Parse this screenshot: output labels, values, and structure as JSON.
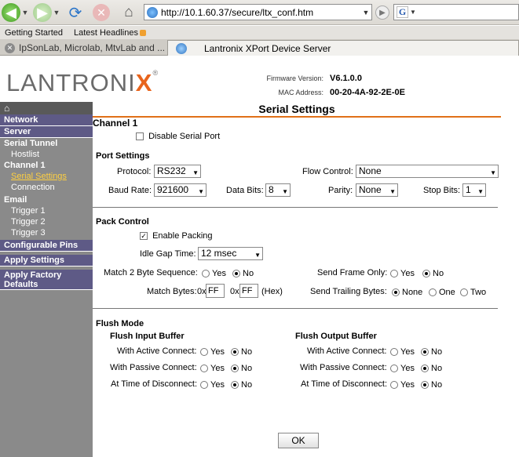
{
  "browser": {
    "url": "http://10.1.60.37/secure/ltx_conf.htm",
    "bookmarks": [
      "Getting Started",
      "Latest Headlines"
    ],
    "tabs": [
      "IpSonLab, Microlab, MtvLab and ...",
      "Lantronix XPort Device Server"
    ],
    "icons": [
      "back-icon",
      "forward-icon",
      "reload-icon",
      "stop-icon",
      "home-icon",
      "go-icon",
      "google-search-icon"
    ]
  },
  "header": {
    "logo_main": "LANTRONI",
    "logo_x": "X",
    "logo_reg": "®",
    "firmware_label": "Firmware Version:",
    "firmware_value": "V6.1.0.0",
    "mac_label": "MAC Address:",
    "mac_value": "00-20-4A-92-2E-0E",
    "brand_color": "#e8641c"
  },
  "sidebar": {
    "home_icon": "⌂",
    "items": [
      {
        "label": "Network"
      },
      {
        "label": "Server"
      },
      {
        "label": "Serial Tunnel"
      },
      {
        "label": "Hostlist"
      },
      {
        "label": "Channel 1"
      },
      {
        "label": "Serial Settings"
      },
      {
        "label": "Connection"
      },
      {
        "label": "Email"
      },
      {
        "label": "Trigger 1"
      },
      {
        "label": "Trigger 2"
      },
      {
        "label": "Trigger 3"
      },
      {
        "label": "Configurable Pins"
      },
      {
        "label": "Apply Settings"
      },
      {
        "label": "Apply Factory Defaults"
      }
    ]
  },
  "main": {
    "title": "Serial Settings",
    "channel": "Channel 1",
    "disable_serial_port": {
      "label": "Disable Serial Port",
      "checked": false
    },
    "port_settings": {
      "heading": "Port Settings",
      "protocol_label": "Protocol:",
      "protocol_value": "RS232",
      "flow_label": "Flow Control:",
      "flow_value": "None",
      "baud_label": "Baud Rate:",
      "baud_value": "921600",
      "databits_label": "Data Bits:",
      "databits_value": "8",
      "parity_label": "Parity:",
      "parity_value": "None",
      "stopbits_label": "Stop Bits:",
      "stopbits_value": "1"
    },
    "pack_control": {
      "heading": "Pack Control",
      "enable_packing": {
        "label": "Enable Packing",
        "checked": true,
        "mark": "✓"
      },
      "idle_gap_label": "Idle Gap Time:",
      "idle_gap_value": "12 msec",
      "match2_label": "Match 2 Byte Sequence:",
      "yes": "Yes",
      "no": "No",
      "send_frame_label": "Send Frame Only:",
      "match_bytes_label": "Match Bytes:",
      "hex_prefix": "0x",
      "byte1": "FF",
      "byte2": "FF",
      "hex_suffix": "(Hex)",
      "send_trailing_label": "Send Trailing Bytes:",
      "trail_none": "None",
      "trail_one": "One",
      "trail_two": "Two"
    },
    "flush_mode": {
      "heading": "Flush Mode",
      "input_heading": "Flush Input Buffer",
      "output_heading": "Flush Output Buffer",
      "active_label": "With Active Connect:",
      "passive_label": "With Passive Connect:",
      "disconnect_label": "At Time of Disconnect:",
      "yes": "Yes",
      "no": "No"
    },
    "ok_label": "OK"
  }
}
